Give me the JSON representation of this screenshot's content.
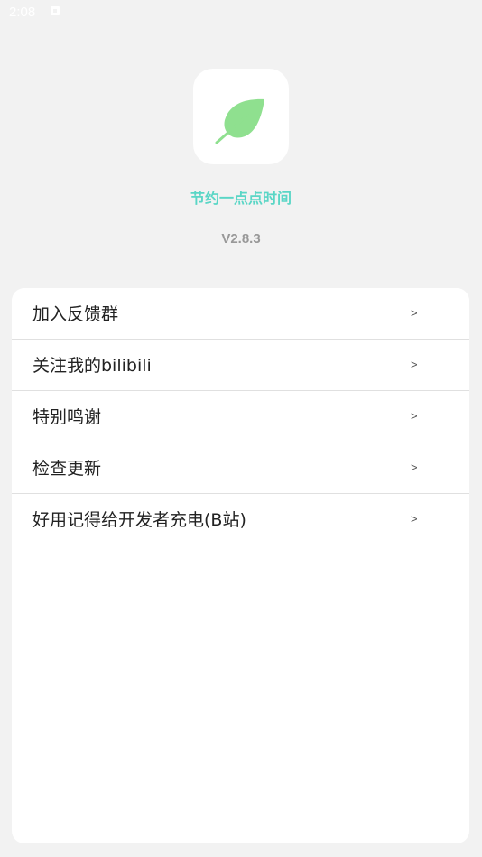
{
  "status_bar": {
    "time": "2:08",
    "notification_icon": "notification-icon"
  },
  "app": {
    "icon": "leaf-icon",
    "slogan": "节约一点点时间",
    "version": "V2.8.3"
  },
  "menu": {
    "items": [
      {
        "label": "加入反馈群",
        "arrow": ">"
      },
      {
        "label": "关注我的bilibili",
        "arrow": ">"
      },
      {
        "label": "特别鸣谢",
        "arrow": ">"
      },
      {
        "label": "检查更新",
        "arrow": ">"
      },
      {
        "label": "好用记得给开发者充电(B站)",
        "arrow": ">"
      }
    ]
  },
  "colors": {
    "background": "#f2f2f2",
    "accent": "#5ad6c6",
    "leaf": "#8fe08f",
    "version_text": "#999999"
  }
}
